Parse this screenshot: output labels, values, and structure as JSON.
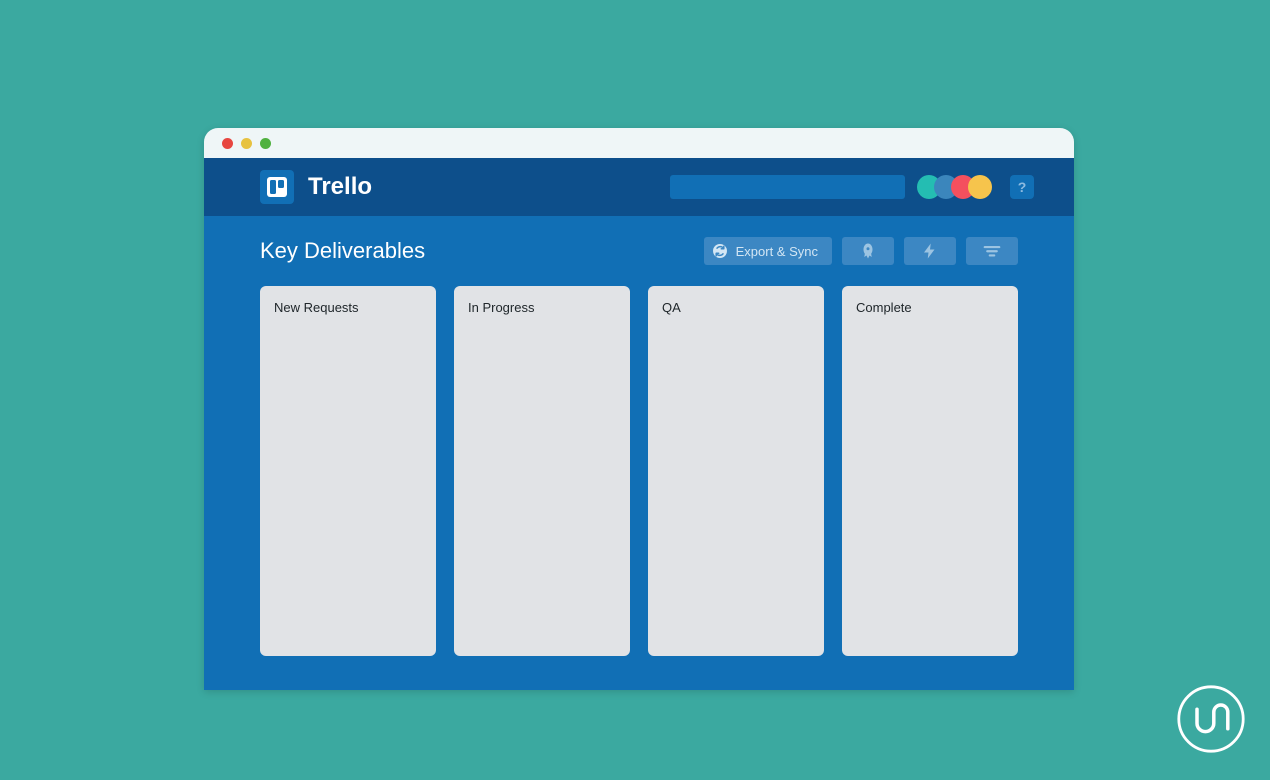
{
  "header": {
    "brand": "Trello",
    "avatar_colors": [
      "#24bdb2",
      "#3b86bc",
      "#f4505e",
      "#f6c44c"
    ]
  },
  "board": {
    "title": "Key Deliverables",
    "export_label": "Export & Sync",
    "lists": [
      {
        "title": "New Requests"
      },
      {
        "title": "In Progress"
      },
      {
        "title": "QA"
      },
      {
        "title": "Complete"
      }
    ]
  }
}
